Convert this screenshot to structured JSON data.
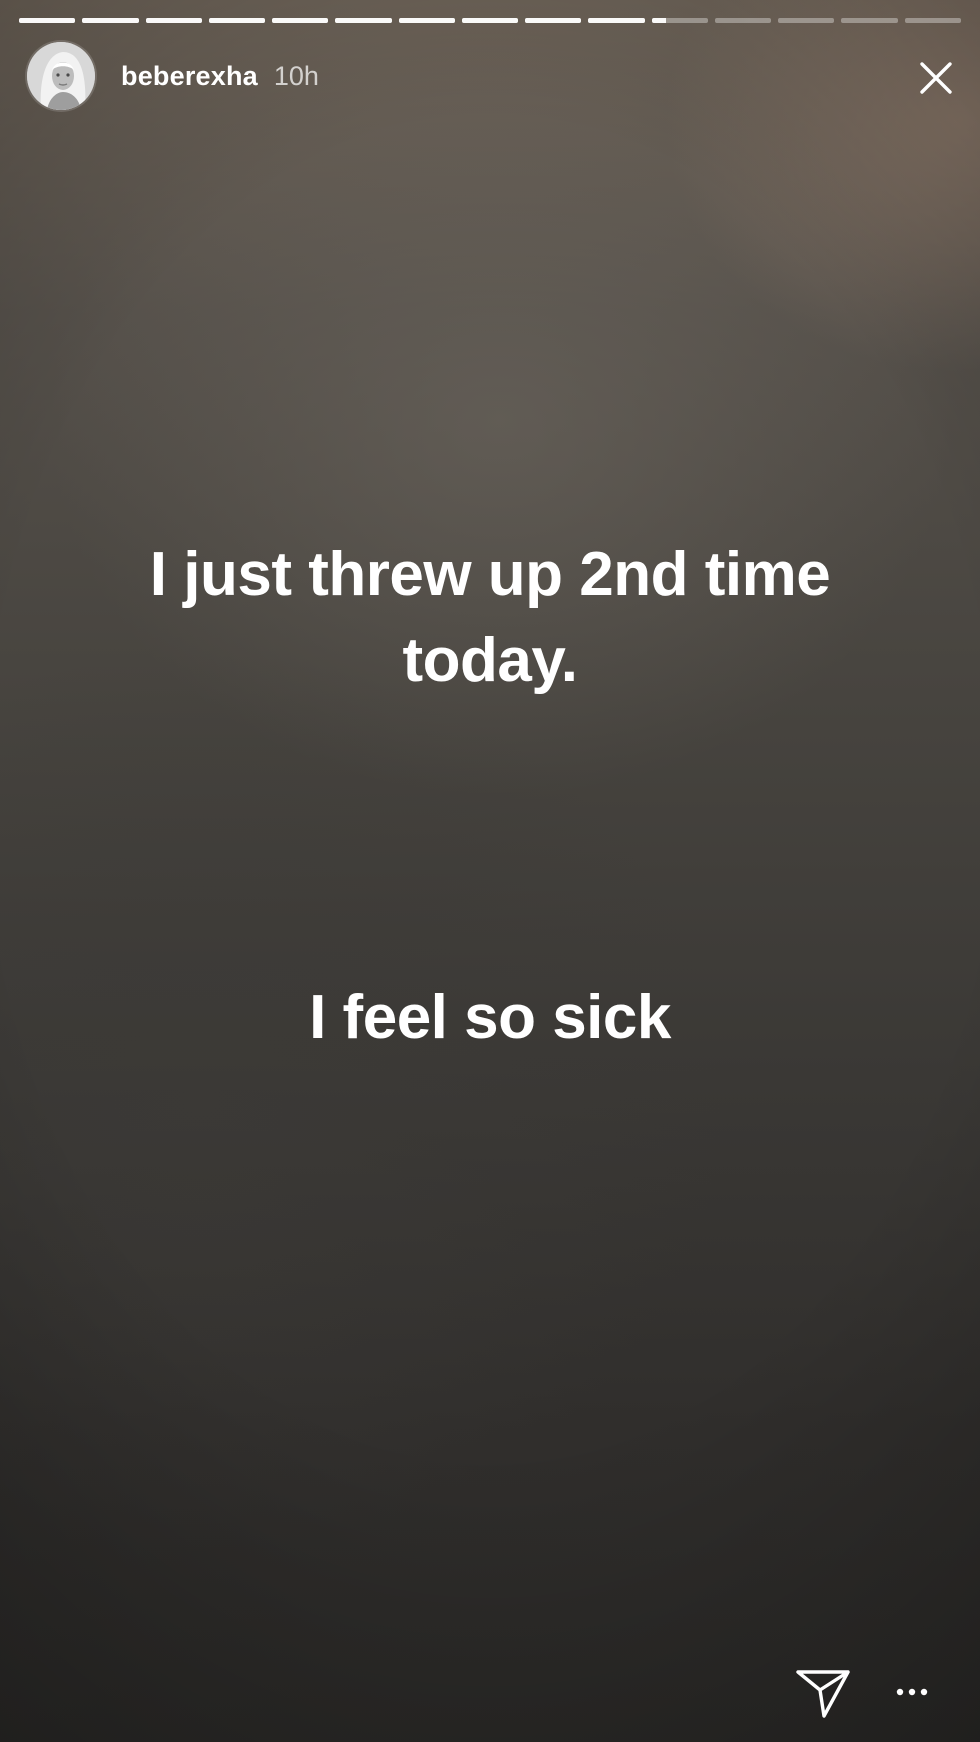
{
  "story": {
    "segments_total": 15,
    "segments_completed": 10,
    "current_segment_progress": 0.25
  },
  "header": {
    "username": "beberexha",
    "timestamp": "10h",
    "avatar_icon": "profile-avatar",
    "close_icon": "close-icon"
  },
  "caption": {
    "line1": "I just threw up 2nd time",
    "line2": "today.",
    "line3": "I feel so sick"
  },
  "footer": {
    "send_icon": "send-icon",
    "more_icon": "more-icon"
  },
  "colors": {
    "text": "#ffffff",
    "progress_filled": "#ffffff",
    "progress_empty": "#ffffff59"
  }
}
